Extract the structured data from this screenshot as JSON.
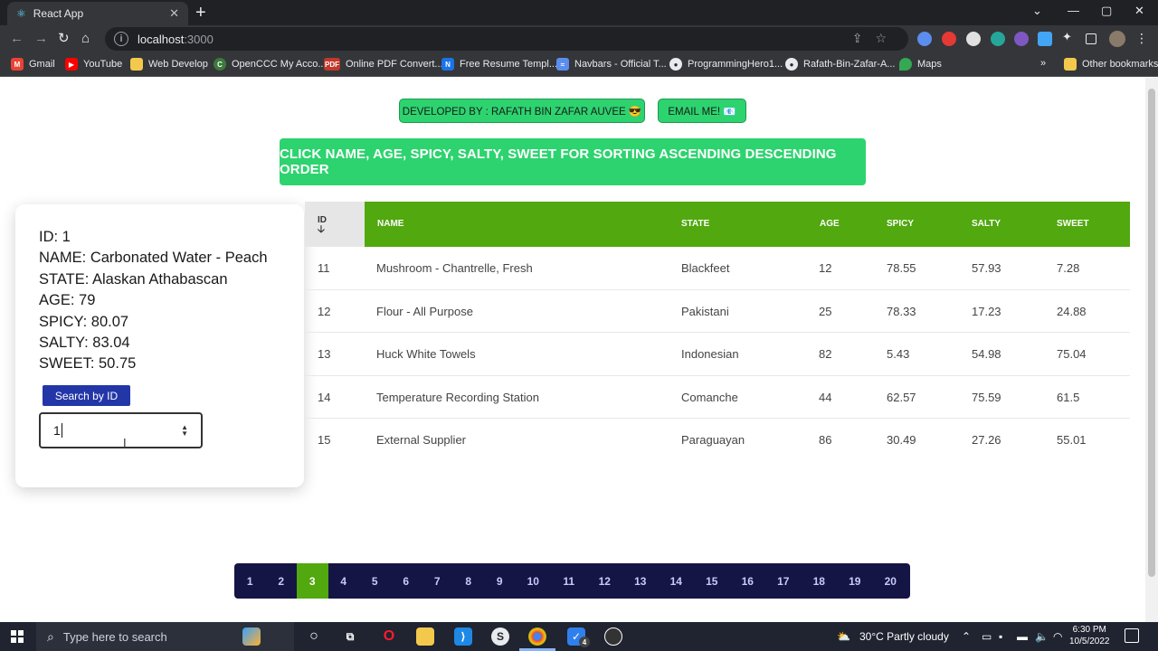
{
  "browser": {
    "tab_title": "React App",
    "url_host": "localhost",
    "url_port": ":3000",
    "bookmarks": [
      {
        "label": "Gmail",
        "icon": "gmail-icon",
        "color": "#ea4335"
      },
      {
        "label": "YouTube",
        "icon": "youtube-icon",
        "color": "#ff0000"
      },
      {
        "label": "Web Develop",
        "icon": "folder-icon",
        "color": "#f2c94c"
      },
      {
        "label": "OpenCCC My Acco...",
        "icon": "openccc-icon",
        "color": "#3b7a3b"
      },
      {
        "label": "Online PDF Convert...",
        "icon": "pdf-icon",
        "color": "#c0392b"
      },
      {
        "label": "Free Resume Templ...",
        "icon": "resume-icon",
        "color": "#1a73e8"
      },
      {
        "label": "Navbars - Official T...",
        "icon": "navbars-icon",
        "color": "#5b8def"
      },
      {
        "label": "ProgrammingHero1...",
        "icon": "github-icon",
        "color": "#24292e"
      },
      {
        "label": "Rafath-Bin-Zafar-A...",
        "icon": "github-icon",
        "color": "#24292e"
      },
      {
        "label": "Maps",
        "icon": "maps-icon",
        "color": "#34a853"
      }
    ],
    "other_bookmarks": "Other bookmarks"
  },
  "header": {
    "developer_label": "DEVELOPED BY : RAFATH BIN ZAFAR AUVEE 😎",
    "email_label": "EMAIL ME! 📧",
    "banner": "CLICK NAME, AGE, SPICY, SALTY, SWEET FOR SORTING ASCENDING DESCENDING ORDER"
  },
  "detail": {
    "id": "ID: 1",
    "name": "NAME: Carbonated Water - Peach",
    "state": "STATE: Alaskan Athabascan",
    "age": "AGE: 79",
    "spicy": "SPICY: 80.07",
    "salty": "SALTY: 83.04",
    "sweet": "SWEET: 50.75",
    "search_button": "Search by ID",
    "input_value": "1"
  },
  "table": {
    "columns": {
      "id": "ID",
      "id_sort": "🡣",
      "name": "NAME",
      "state": "STATE",
      "age": "AGE",
      "spicy": "SPICY",
      "salty": "SALTY",
      "sweet": "SWEET"
    },
    "rows": [
      {
        "id": "11",
        "name": "Mushroom - Chantrelle, Fresh",
        "state": "Blackfeet",
        "age": "12",
        "spicy": "78.55",
        "salty": "57.93",
        "sweet": "7.28"
      },
      {
        "id": "12",
        "name": "Flour - All Purpose",
        "state": "Pakistani",
        "age": "25",
        "spicy": "78.33",
        "salty": "17.23",
        "sweet": "24.88"
      },
      {
        "id": "13",
        "name": "Huck White Towels",
        "state": "Indonesian",
        "age": "82",
        "spicy": "5.43",
        "salty": "54.98",
        "sweet": "75.04"
      },
      {
        "id": "14",
        "name": "Temperature Recording Station",
        "state": "Comanche",
        "age": "44",
        "spicy": "62.57",
        "salty": "75.59",
        "sweet": "61.5"
      },
      {
        "id": "15",
        "name": "External Supplier",
        "state": "Paraguayan",
        "age": "86",
        "spicy": "30.49",
        "salty": "27.26",
        "sweet": "55.01"
      }
    ]
  },
  "pagination": {
    "pages": [
      "1",
      "2",
      "3",
      "4",
      "5",
      "6",
      "7",
      "8",
      "9",
      "10",
      "11",
      "12",
      "13",
      "14",
      "15",
      "16",
      "17",
      "18",
      "19",
      "20"
    ],
    "active": "3"
  },
  "taskbar": {
    "search_placeholder": "Type here to search",
    "weather": "30°C  Partly cloudy",
    "time": "6:30 PM",
    "date": "10/5/2022",
    "badge": "4"
  }
}
